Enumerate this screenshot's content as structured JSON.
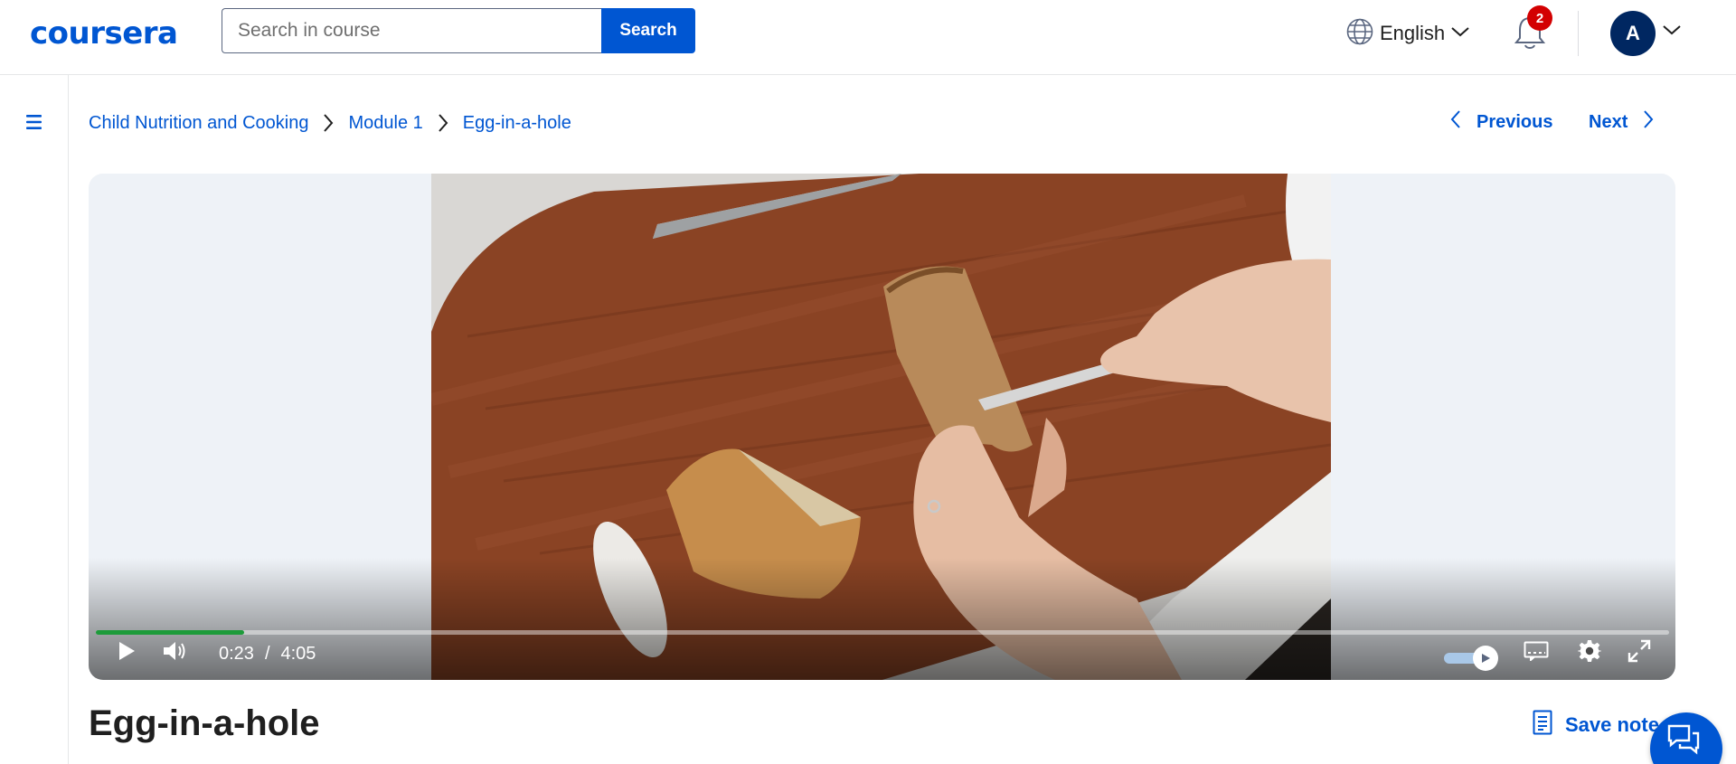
{
  "header": {
    "logo_text": "coursera",
    "search_placeholder": "Search in course",
    "search_button": "Search",
    "language": "English",
    "notification_count": "2",
    "avatar_initial": "A"
  },
  "breadcrumbs": [
    {
      "label": "Child Nutrition and Cooking"
    },
    {
      "label": "Module 1"
    },
    {
      "label": "Egg-in-a-hole"
    }
  ],
  "navigation": {
    "previous": "Previous",
    "next": "Next"
  },
  "player": {
    "current_time": "0:23",
    "separator": "/",
    "duration": "4:05",
    "progress_fraction": 0.094
  },
  "content": {
    "title": "Egg-in-a-hole",
    "save_note": "Save note"
  },
  "colors": {
    "brand": "#0056d2",
    "progress": "#1d9b3a",
    "badge": "#d30001",
    "avatar": "#002761"
  },
  "icons": [
    "globe-icon",
    "chevron-down-icon",
    "bell-icon",
    "menu-icon",
    "chevron-right-icon",
    "chevron-left-icon",
    "play-icon",
    "volume-icon",
    "captions-icon",
    "settings-icon",
    "fullscreen-icon",
    "note-icon",
    "chat-icon"
  ]
}
